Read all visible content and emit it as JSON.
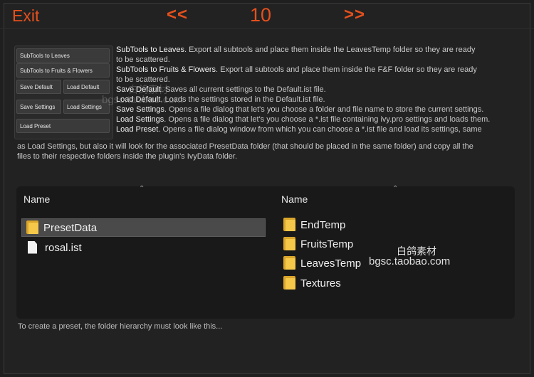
{
  "topbar": {
    "exit_label": "Exit",
    "prev_label": "<<",
    "page_number": "10",
    "next_label": ">>"
  },
  "buttons": {
    "subtools_leaves": "SubTools to Leaves",
    "subtools_fruits": "SubTools to Fruits & Flowers",
    "save_default": "Save Default",
    "load_default": "Load Default",
    "save_settings": "Save Settings",
    "load_settings": "Load Settings",
    "load_preset": "Load Preset"
  },
  "descriptions": {
    "leaves_term": "SubTools to Leaves",
    "leaves_text_1": ". Export all subtools and place them inside the LeavesTemp folder so they are ready",
    "leaves_text_2": "to be scattered.",
    "fruits_term": "SubTools to Fruits & Flowers",
    "fruits_text_1": ".  Export all subtools and place them inside the F&F folder so they are ready",
    "fruits_text_2": "to be scattered.",
    "save_default_term": "Save Default",
    "save_default_text": ". Saves all current settings to the Default.ist file.",
    "load_default_term": "Load Default",
    "load_default_text": ". Loads the settings stored in the Default.ist file.",
    "save_settings_term": "Save Settings",
    "save_settings_text": ". Opens a file dialog that let's you choose a folder and file name to store the current settings.",
    "load_settings_term": "Load Settings",
    "load_settings_text": ". Opens a file dialog that let's you choose a *.ist file containing ivy.pro settings and loads them.",
    "load_preset_term": "Load Preset",
    "load_preset_text": ". Opens a file dialog window from which you can choose a *.ist file and load its settings, same",
    "wrap_line_1": "as Load Settings, but also it will look for the associated PresetData folder (that should be placed  in the same folder) and copy all the",
    "wrap_line_2": "files to their respective folders inside the plugin's IvyData folder."
  },
  "explorer": {
    "left_header": "Name",
    "right_header": "Name",
    "left_items": [
      {
        "label": "PresetData",
        "icon": "folder-icon"
      },
      {
        "label": "rosal.ist",
        "icon": "file-icon"
      }
    ],
    "right_items": [
      {
        "label": "EndTemp",
        "icon": "folder-icon"
      },
      {
        "label": "FruitsTemp",
        "icon": "folder-icon"
      },
      {
        "label": "LeavesTemp",
        "icon": "folder-icon"
      },
      {
        "label": "Textures",
        "icon": "folder-icon"
      }
    ]
  },
  "footer": {
    "text": "To create a preset, the folder hierarchy must look like this..."
  },
  "watermarks": {
    "cn_1": "白鸽素材",
    "url_1": "bgsc.taobao.com",
    "cn_2": "白鸽素材",
    "url_2": "bgsc.taobao.com"
  },
  "colors": {
    "accent": "#e6501d",
    "background": "#222222",
    "folder": "#f5c84a"
  }
}
